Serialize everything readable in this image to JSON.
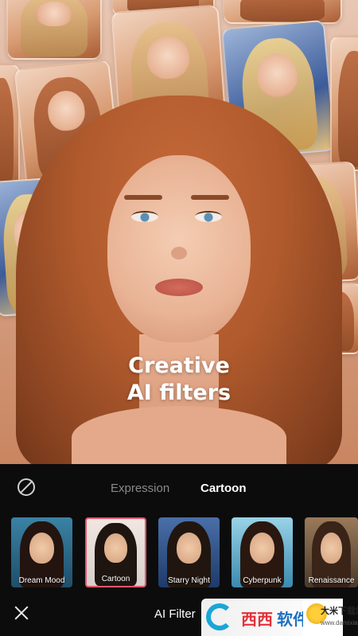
{
  "hero": {
    "title_line1": "Creative",
    "title_line2": "AI filters"
  },
  "tabs": [
    {
      "label": "Expression",
      "selected": false
    },
    {
      "label": "Cartoon",
      "selected": true
    }
  ],
  "filters": [
    {
      "label": "Dream Mood",
      "selected": false
    },
    {
      "label": "Cartoon",
      "selected": true
    },
    {
      "label": "Starry Night",
      "selected": false
    },
    {
      "label": "Cyberpunk",
      "selected": false
    },
    {
      "label": "Renaissance",
      "selected": false
    }
  ],
  "bottom_bar": {
    "title": "AI Filter"
  },
  "watermark": {
    "brand_text_1": "西西",
    "brand_text_2": "软件园",
    "site_name": "大米下载站",
    "site_url": "www.damixia.com"
  },
  "colors": {
    "panel_bg": "#0c0c0c",
    "selected_border": "#e0576c",
    "tab_inactive": "#8a8a8a",
    "tab_active": "#ffffff"
  }
}
